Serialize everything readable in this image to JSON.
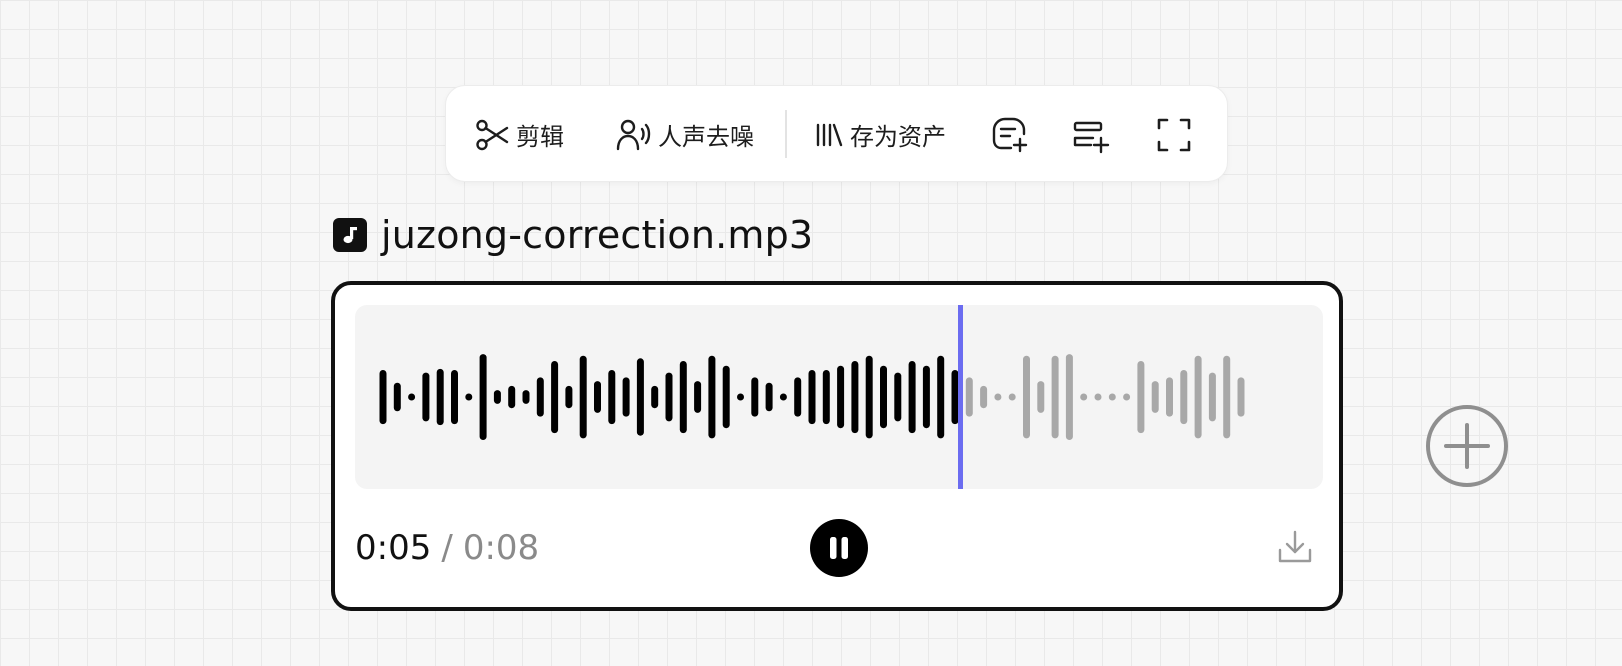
{
  "toolbar": {
    "items": [
      {
        "label": "剪辑",
        "icon": "scissors-icon"
      },
      {
        "label": "人声去噪",
        "icon": "voice-denoise-icon"
      },
      {
        "label": "存为资产",
        "icon": "library-icon"
      }
    ],
    "icon_buttons": [
      "add-note-icon",
      "add-to-track-icon",
      "fullscreen-icon"
    ]
  },
  "file": {
    "icon": "music-note-icon",
    "name": "juzong-correction.mp3"
  },
  "player": {
    "current_time": "0:05",
    "separator": "/",
    "total_time": "0:08",
    "progress": 0.625,
    "play_state": "pause-icon",
    "download_icon": "download-icon",
    "colors": {
      "played": "#000000",
      "unplayed": "#a8a8a8",
      "playhead": "#6b6cf0",
      "wave_background": "#f4f4f4"
    },
    "waveform_levels": [
      0.51,
      0.27,
      0.06,
      0.46,
      0.53,
      0.51,
      0.06,
      0.81,
      0.13,
      0.21,
      0.13,
      0.37,
      0.68,
      0.21,
      0.78,
      0.3,
      0.51,
      0.37,
      0.73,
      0.21,
      0.46,
      0.68,
      0.3,
      0.78,
      0.59,
      0.06,
      0.37,
      0.27,
      0.06,
      0.37,
      0.51,
      0.51,
      0.59,
      0.68,
      0.78,
      0.59,
      0.46,
      0.68,
      0.59,
      0.78,
      0.51,
      0.37,
      0.21,
      0.06,
      0.06,
      0.78,
      0.3,
      0.78,
      0.81,
      0.06,
      0.06,
      0.06,
      0.06,
      0.68,
      0.3,
      0.37,
      0.51,
      0.78,
      0.46,
      0.78,
      0.37
    ]
  },
  "canvas": {
    "add_icon": "plus-circle-icon"
  }
}
